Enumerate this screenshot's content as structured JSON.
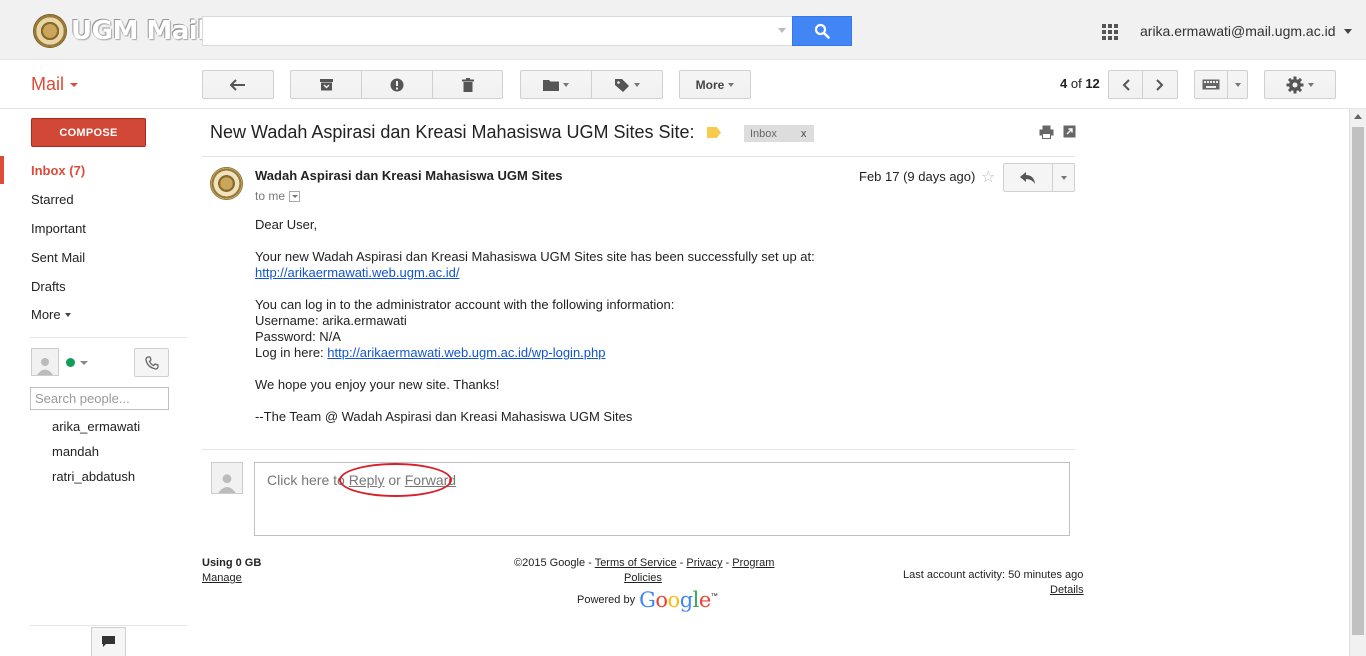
{
  "header": {
    "logo_text": "UGM Mail",
    "search_value": "",
    "account_email": "arika.ermawati@mail.ugm.ac.id"
  },
  "toolbar": {
    "mail_label": "Mail",
    "more_label": "More",
    "pager_current": "4",
    "pager_of": "of",
    "pager_total": "12"
  },
  "sidebar": {
    "compose_label": "COMPOSE",
    "items": [
      {
        "label": "Inbox (7)"
      },
      {
        "label": "Starred"
      },
      {
        "label": "Important"
      },
      {
        "label": "Sent Mail"
      },
      {
        "label": "Drafts"
      },
      {
        "label": "More"
      }
    ],
    "chat": {
      "search_placeholder": "Search people...",
      "contacts": [
        "arika_ermawati",
        "mandah",
        "ratri_abdatush"
      ]
    }
  },
  "message": {
    "subject": "New Wadah Aspirasi dan Kreasi Mahasiswa UGM Sites Site:",
    "label_chip": "Inbox",
    "label_chip_close": "x",
    "sender": "Wadah Aspirasi dan Kreasi Mahasiswa UGM Sites",
    "recipient": "to me",
    "date": "Feb 17 (9 days ago)",
    "body": {
      "greeting": "Dear User,",
      "line1": "Your new Wadah Aspirasi dan Kreasi Mahasiswa UGM Sites site has been successfully set up at:",
      "site_url": "http://arikaermawati.web.ugm.ac.id/",
      "line2": "You can log in to the administrator account with the following information:",
      "username_line": "Username: arika.ermawati",
      "password_line": "Password: N/A",
      "login_prefix": "Log in here: ",
      "login_url": "http://arikaermawati.web.ugm.ac.id/wp-login.php",
      "line3": "We hope you enjoy your new site. Thanks!",
      "signature": "--The Team @ Wadah Aspirasi dan Kreasi Mahasiswa UGM Sites"
    },
    "reply_prompt": {
      "prefix": "Click here to ",
      "reply": "Reply",
      "middle": " or ",
      "forward": "Forward"
    }
  },
  "footer": {
    "storage_used": "Using 0 GB",
    "manage": "Manage",
    "copyright": "©2015 Google - ",
    "terms": "Terms of Service",
    "dash1": " - ",
    "privacy": "Privacy",
    "dash2": " - ",
    "program": "Program",
    "policies": "Policies",
    "powered_by": "Powered by",
    "google_word": "Google",
    "google_tm": "™",
    "last_activity": "Last account activity: 50 minutes ago",
    "details": "Details"
  },
  "colors": {
    "accent_red": "#dd4b39",
    "search_blue": "#4285f4",
    "link_blue": "#1155cc",
    "annotation_red": "#d7202a"
  }
}
